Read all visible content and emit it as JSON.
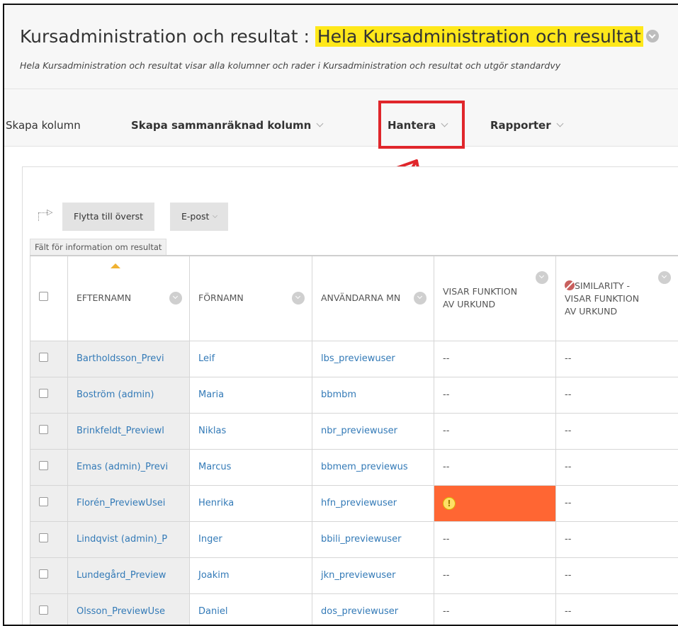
{
  "header": {
    "title_prefix": "Kursadministration och resultat :",
    "title_highlight": "Hela Kursadministration och resultat",
    "subtitle": "Hela Kursadministration och resultat visar alla kolumner och rader i Kursadministration och resultat och utgör standardvy"
  },
  "toolbar": {
    "create_column": "Skapa kolumn",
    "create_calculated_column": "Skapa sammanräknad kolumn",
    "manage": "Hantera",
    "reports": "Rapporter"
  },
  "actions": {
    "move_to_top": "Flytta till överst",
    "email": "E-post",
    "info_field_label": "Fält för information om resultat"
  },
  "table": {
    "headers": {
      "lastname": "EFTERNAMN",
      "firstname": "FÖRNAMN",
      "username": "ANVÄNDARNA MN",
      "visar": "VISAR FUNKTION AV URKUND",
      "similarity": "SIMILARITY - VISAR FUNKTION AV URKUND"
    },
    "rows": [
      {
        "lastname": "Bartholdsson_Previ",
        "firstname": "Leif",
        "username": "lbs_previewuser",
        "visar": "--",
        "similarity": "--"
      },
      {
        "lastname": "Boström (admin)",
        "firstname": "Maria",
        "username": "bbmbm",
        "visar": "--",
        "similarity": "--"
      },
      {
        "lastname": "Brinkfeldt_Previewl",
        "firstname": "Niklas",
        "username": "nbr_previewuser",
        "visar": "--",
        "similarity": "--"
      },
      {
        "lastname": "Emas (admin)_Previ",
        "firstname": "Marcus",
        "username": "bbmem_previewus",
        "visar": "--",
        "similarity": "--"
      },
      {
        "lastname": "Florén_PreviewUsei",
        "firstname": "Henrika",
        "username": "hfn_previewuser",
        "visar": "!",
        "similarity": "--"
      },
      {
        "lastname": "Lindqvist (admin)_P",
        "firstname": "Inger",
        "username": "bbili_previewuser",
        "visar": "--",
        "similarity": "--"
      },
      {
        "lastname": "Lundegård_Preview",
        "firstname": "Joakim",
        "username": "jkn_previewuser",
        "visar": "--",
        "similarity": "--"
      },
      {
        "lastname": "Olsson_PreviewUse",
        "firstname": "Daniel",
        "username": "dos_previewuser",
        "visar": "--",
        "similarity": "--"
      }
    ]
  },
  "colors": {
    "highlight": "#ffe81a",
    "annotation_red": "#e0262b",
    "alert_cell": "#ff6633",
    "link": "#337ab7"
  }
}
